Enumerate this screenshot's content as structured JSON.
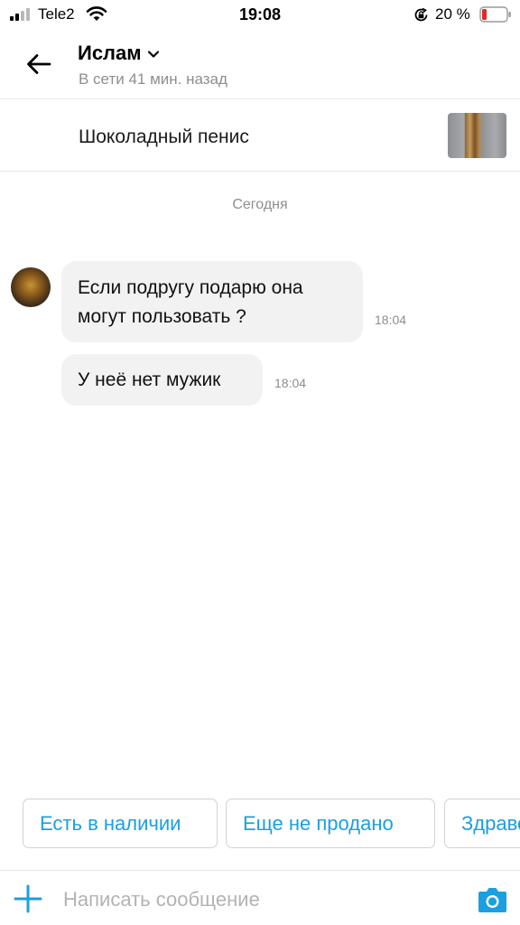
{
  "status_bar": {
    "carrier": "Tele2",
    "time": "19:08",
    "battery_percent": "20 %",
    "icons": [
      "signal-icon",
      "wifi-icon",
      "orientation-lock-icon",
      "battery-icon"
    ]
  },
  "header": {
    "contact_name": "Ислам",
    "contact_status": "В сети 41 мин. назад",
    "icons": [
      "back-arrow-icon",
      "chevron-down-icon"
    ]
  },
  "product": {
    "title": "Шоколадный пенис"
  },
  "chat": {
    "date_label": "Сегодня",
    "messages": [
      {
        "text": "Если подругу подарю она могут пользовать ?",
        "time": "18:04"
      },
      {
        "text": "У неё нет мужик",
        "time": "18:04"
      }
    ]
  },
  "quick_replies": [
    "Есть в наличии",
    "Еще не продано",
    "Здравс"
  ],
  "composer": {
    "placeholder": "Написать сообщение",
    "icons": [
      "plus-icon",
      "camera-icon"
    ]
  },
  "colors": {
    "accent": "#1b9fe0",
    "bubble": "#f2f2f2",
    "secondary_text": "#8e8e8e",
    "battery_low": "#e02b2b"
  }
}
